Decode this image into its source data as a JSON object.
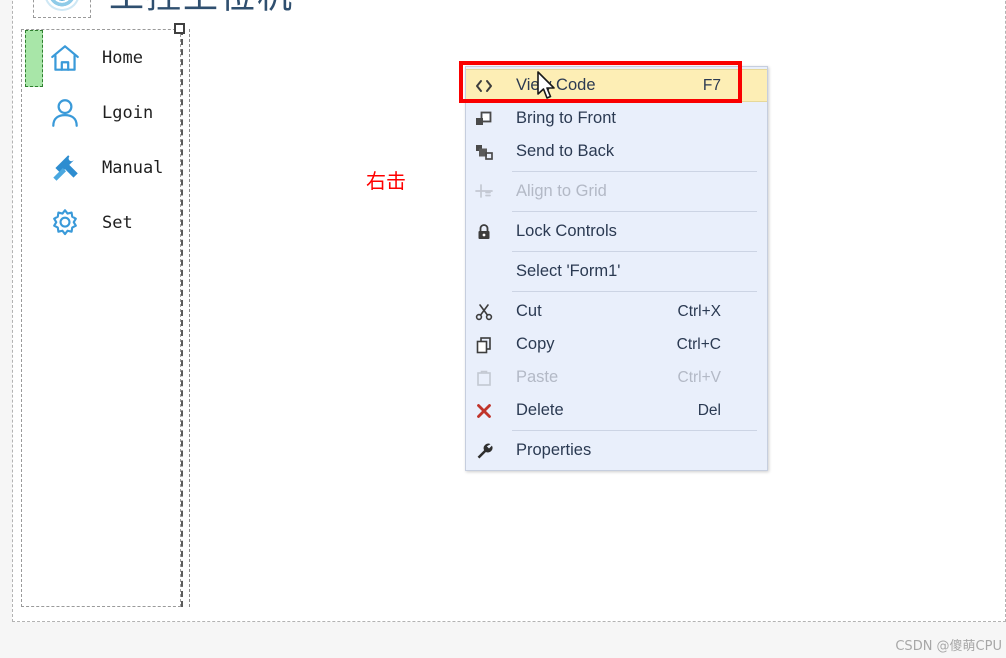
{
  "app": {
    "title": "工控上位机",
    "logo_icon": "swirl-logo-icon"
  },
  "sidebar": {
    "items": [
      {
        "label": "Home",
        "icon": "home-icon",
        "selected": true
      },
      {
        "label": "Lgoin",
        "icon": "user-icon",
        "selected": false
      },
      {
        "label": "Manual",
        "icon": "tools-icon",
        "selected": false
      },
      {
        "label": "Set",
        "icon": "gear-icon",
        "selected": false
      }
    ]
  },
  "annotation": {
    "right_click_label": "右击",
    "color": "#ff0000",
    "highlight_rect_color": "#fa0000"
  },
  "context_menu": {
    "background": "#e9effb",
    "highlight_background": "#fdeeb5",
    "items": [
      {
        "label": "View Code",
        "shortcut": "F7",
        "icon": "code-brackets-icon",
        "highlighted": true,
        "disabled": false,
        "separator_after": false
      },
      {
        "label": "Bring to Front",
        "shortcut": "",
        "icon": "bring-to-front-icon",
        "highlighted": false,
        "disabled": false,
        "separator_after": false
      },
      {
        "label": "Send to Back",
        "shortcut": "",
        "icon": "send-to-back-icon",
        "highlighted": false,
        "disabled": false,
        "separator_after": true
      },
      {
        "label": "Align to Grid",
        "shortcut": "",
        "icon": "align-to-grid-icon",
        "highlighted": false,
        "disabled": true,
        "separator_after": true
      },
      {
        "label": "Lock Controls",
        "shortcut": "",
        "icon": "lock-icon",
        "highlighted": false,
        "disabled": false,
        "separator_after": true
      },
      {
        "label": "Select 'Form1'",
        "shortcut": "",
        "icon": "none",
        "highlighted": false,
        "disabled": false,
        "separator_after": true
      },
      {
        "label": "Cut",
        "shortcut": "Ctrl+X",
        "icon": "scissors-icon",
        "highlighted": false,
        "disabled": false,
        "separator_after": false
      },
      {
        "label": "Copy",
        "shortcut": "Ctrl+C",
        "icon": "copy-icon",
        "highlighted": false,
        "disabled": false,
        "separator_after": false
      },
      {
        "label": "Paste",
        "shortcut": "Ctrl+V",
        "icon": "paste-icon",
        "highlighted": false,
        "disabled": true,
        "separator_after": false
      },
      {
        "label": "Delete",
        "shortcut": "Del",
        "icon": "delete-x-icon",
        "highlighted": false,
        "disabled": false,
        "separator_after": true
      },
      {
        "label": "Properties",
        "shortcut": "",
        "icon": "wrench-icon",
        "highlighted": false,
        "disabled": false,
        "separator_after": false
      }
    ]
  },
  "watermark": {
    "text": "CSDN @傻萌CPU"
  }
}
